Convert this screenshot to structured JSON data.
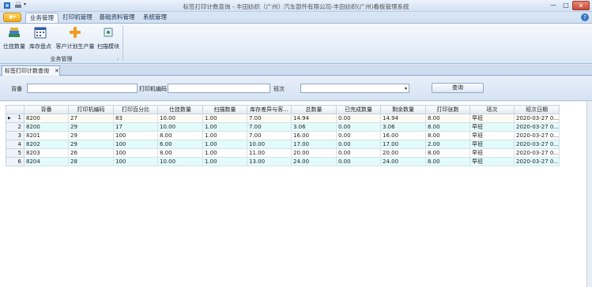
{
  "window": {
    "title": "标签打印计数查询 - 丰田纺织（广州）汽车部件有限公司-丰田纺织(广州)看板管理系统",
    "min_label": "—",
    "max_label": "□",
    "close_label": "✕"
  },
  "quick_access": {
    "dropdown_label": "▾"
  },
  "app_button": {
    "label": "▣▾"
  },
  "ribbon": {
    "tabs": [
      {
        "label": "业务管理",
        "active": true
      },
      {
        "label": "打印机管理",
        "active": false
      },
      {
        "label": "基础资料管理",
        "active": false
      },
      {
        "label": "系统管理",
        "active": false
      }
    ],
    "help_label": "?",
    "buttons": [
      {
        "label": "仕挂数量",
        "icon": "stack-books-icon"
      },
      {
        "label": "库存盘点",
        "icon": "calendar-grid-icon"
      },
      {
        "label": "客户计划生产量",
        "icon": "plus-icon"
      },
      {
        "label": "扫描模块",
        "icon": "scanner-icon"
      }
    ],
    "group_label": "业务管理",
    "launcher_label": "⌟"
  },
  "doc_tab": {
    "label": "标签打印计数查询",
    "close_label": "✕"
  },
  "filter": {
    "beikan_label": "背番",
    "beikan_value": "",
    "printer_code_label": "打印机编码",
    "printer_code_value": "",
    "shift_label": "班次",
    "shift_value": "",
    "shift_arrow": "▾",
    "query_button": "查询"
  },
  "grid": {
    "columns": [
      "背番",
      "打印机编码",
      "打印百分比",
      "仕挂数量",
      "扫描数量",
      "库存差异与客...",
      "总数量",
      "已完成数量",
      "剩余数量",
      "打印张数",
      "班次",
      "班次日期"
    ],
    "selected_pointer": "▶",
    "rows": [
      {
        "num": "1",
        "cells": [
          "8200",
          "27",
          "83",
          "10.00",
          "1.00",
          "7.00",
          "14.94",
          "0.00",
          "14.94",
          "8.00",
          "早班",
          "2020-03-27 0..."
        ]
      },
      {
        "num": "2",
        "cells": [
          "8200",
          "29",
          "17",
          "10.00",
          "1.00",
          "7.00",
          "3.06",
          "0.00",
          "3.06",
          "8.00",
          "早班",
          "2020-03-27 0..."
        ]
      },
      {
        "num": "3",
        "cells": [
          "8201",
          "29",
          "100",
          "8.00",
          "1.00",
          "7.00",
          "16.00",
          "0.00",
          "16.00",
          "8.00",
          "早班",
          "2020-03-27 0..."
        ]
      },
      {
        "num": "4",
        "cells": [
          "8202",
          "29",
          "100",
          "6.00",
          "1.00",
          "10.00",
          "17.00",
          "0.00",
          "17.00",
          "2.00",
          "早班",
          "2020-03-27 0..."
        ]
      },
      {
        "num": "5",
        "cells": [
          "8203",
          "26",
          "100",
          "8.00",
          "1.00",
          "11.00",
          "20.00",
          "0.00",
          "20.00",
          "8.00",
          "早班",
          "2020-03-27 0..."
        ]
      },
      {
        "num": "6",
        "cells": [
          "8204",
          "28",
          "100",
          "10.00",
          "1.00",
          "13.00",
          "24.00",
          "0.00",
          "24.00",
          "8.00",
          "早班",
          "2020-03-27 0..."
        ]
      }
    ]
  }
}
